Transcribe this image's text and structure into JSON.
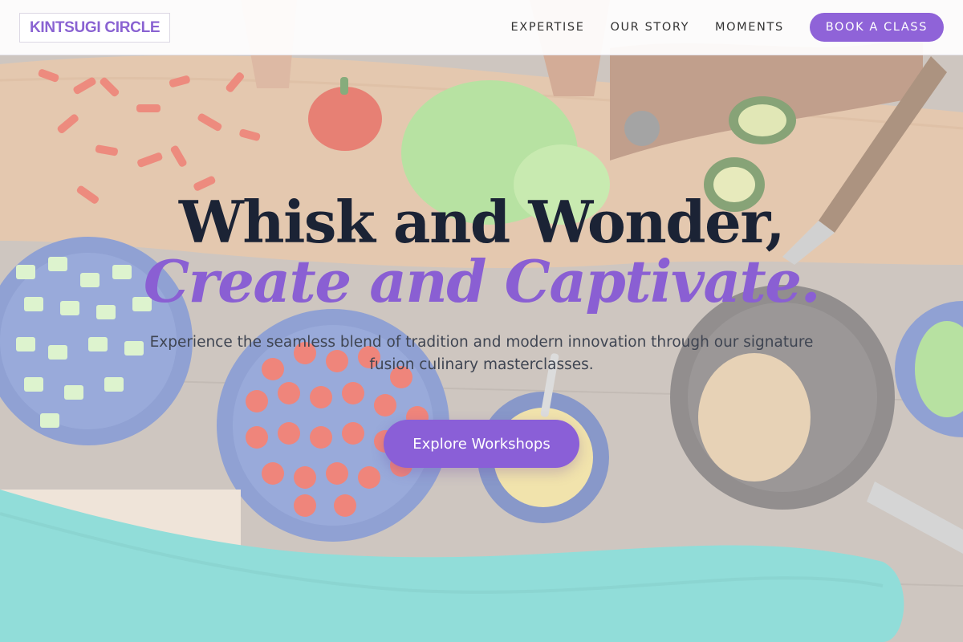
{
  "brand": {
    "logo_text": "KINTSUGI CIRCLE"
  },
  "nav": {
    "links": [
      {
        "label": "EXPERTISE"
      },
      {
        "label": "OUR STORY"
      },
      {
        "label": "MOMENTS"
      }
    ],
    "cta_label": "BOOK A CLASS"
  },
  "hero": {
    "headline_line1": "Whisk and Wonder,",
    "headline_line2": "Create and Captivate.",
    "subtitle": "Experience the seamless blend of tradition and modern innovation through our signature fusion culinary masterclasses.",
    "button_label": "Explore Workshops"
  },
  "colors": {
    "accent": "#8a5fd7",
    "headline_dark": "#1b2335",
    "text_muted": "#3f4552"
  }
}
